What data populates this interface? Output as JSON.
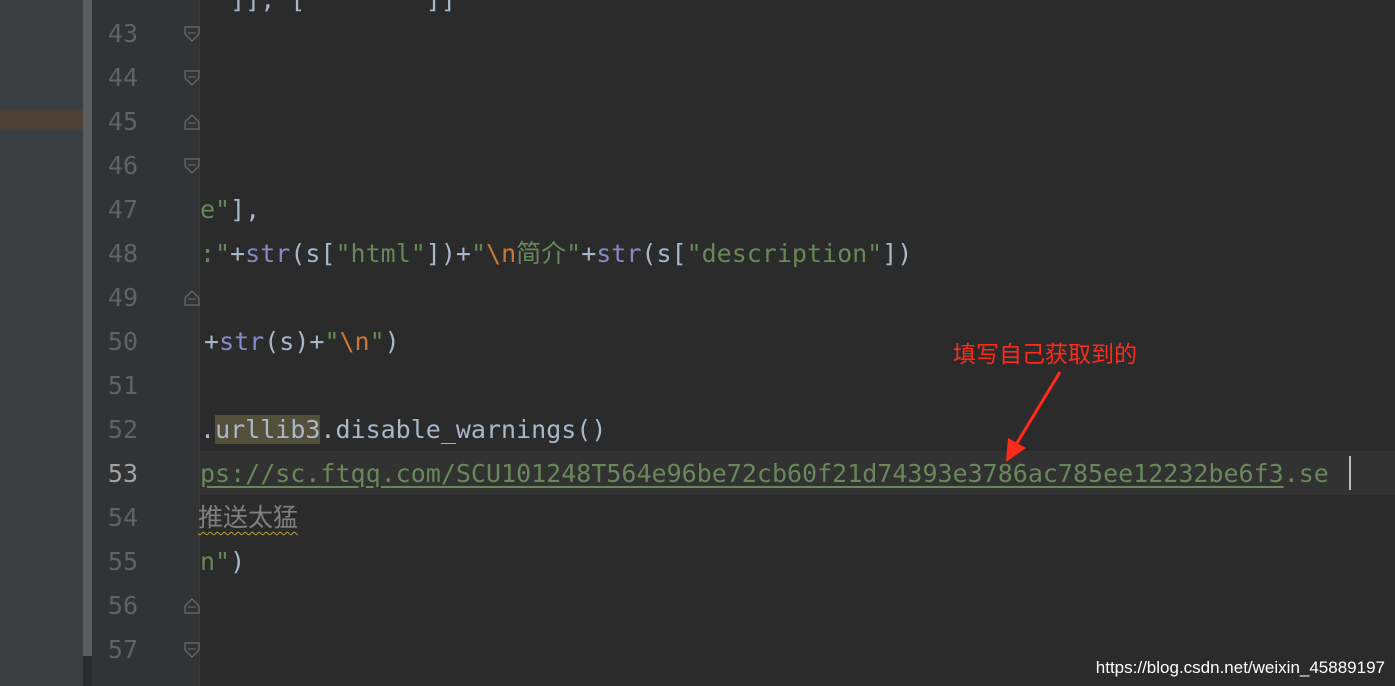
{
  "editor": {
    "top_fragment": "  ]], [        ]]",
    "line_numbers": [
      "43",
      "44",
      "45",
      "46",
      "47",
      "48",
      "49",
      "50",
      "51",
      "52",
      "53",
      "54",
      "55",
      "56",
      "57"
    ],
    "current_line": "53",
    "lines": {
      "l47": {
        "a": "e\"",
        "b": "],",
        "c": ""
      },
      "l48": {
        "p1": ":\"",
        "p2": "+",
        "p3": "str",
        "p4": "(s[",
        "p5": "\"html\"",
        "p6": "])+",
        "p7": "\"",
        "p8": "\\n",
        "p9": "简介\"",
        "p10": "+",
        "p11": "str",
        "p12": "(s[",
        "p13": "\"description\"",
        "p14": "])"
      },
      "l50": {
        "p1": "+",
        "p2": "str",
        "p3": "(s)+",
        "p4": "\"",
        "p5": "\\n",
        "p6": "\"",
        "p7": ")"
      },
      "l52": {
        "p1": ".",
        "p2": "urllib3",
        "p3": ".disable_warnings()"
      },
      "l53": {
        "url": "ps://sc.ftqq.com/SCU101248T564e96be72cb60f21d74393e3786ac785ee12232be6f3",
        "rest": ".se"
      },
      "l54": {
        "comment": "推送太猛"
      },
      "l55": {
        "p1": "n\"",
        "p2": ")"
      }
    }
  },
  "annotation": {
    "text": "填写自己获取到的",
    "color": "#ff2a1a"
  },
  "watermark": {
    "text": "https://blog.csdn.net/weixin_45889197"
  },
  "colors": {
    "background": "#2b2b2b",
    "gutter": "#313335",
    "string": "#6a8759",
    "keyword": "#cc7832",
    "builtin": "#8888c6",
    "text": "#a9b7c6"
  },
  "icons": [
    "fold-marker-icon",
    "annotation-arrow-icon"
  ]
}
